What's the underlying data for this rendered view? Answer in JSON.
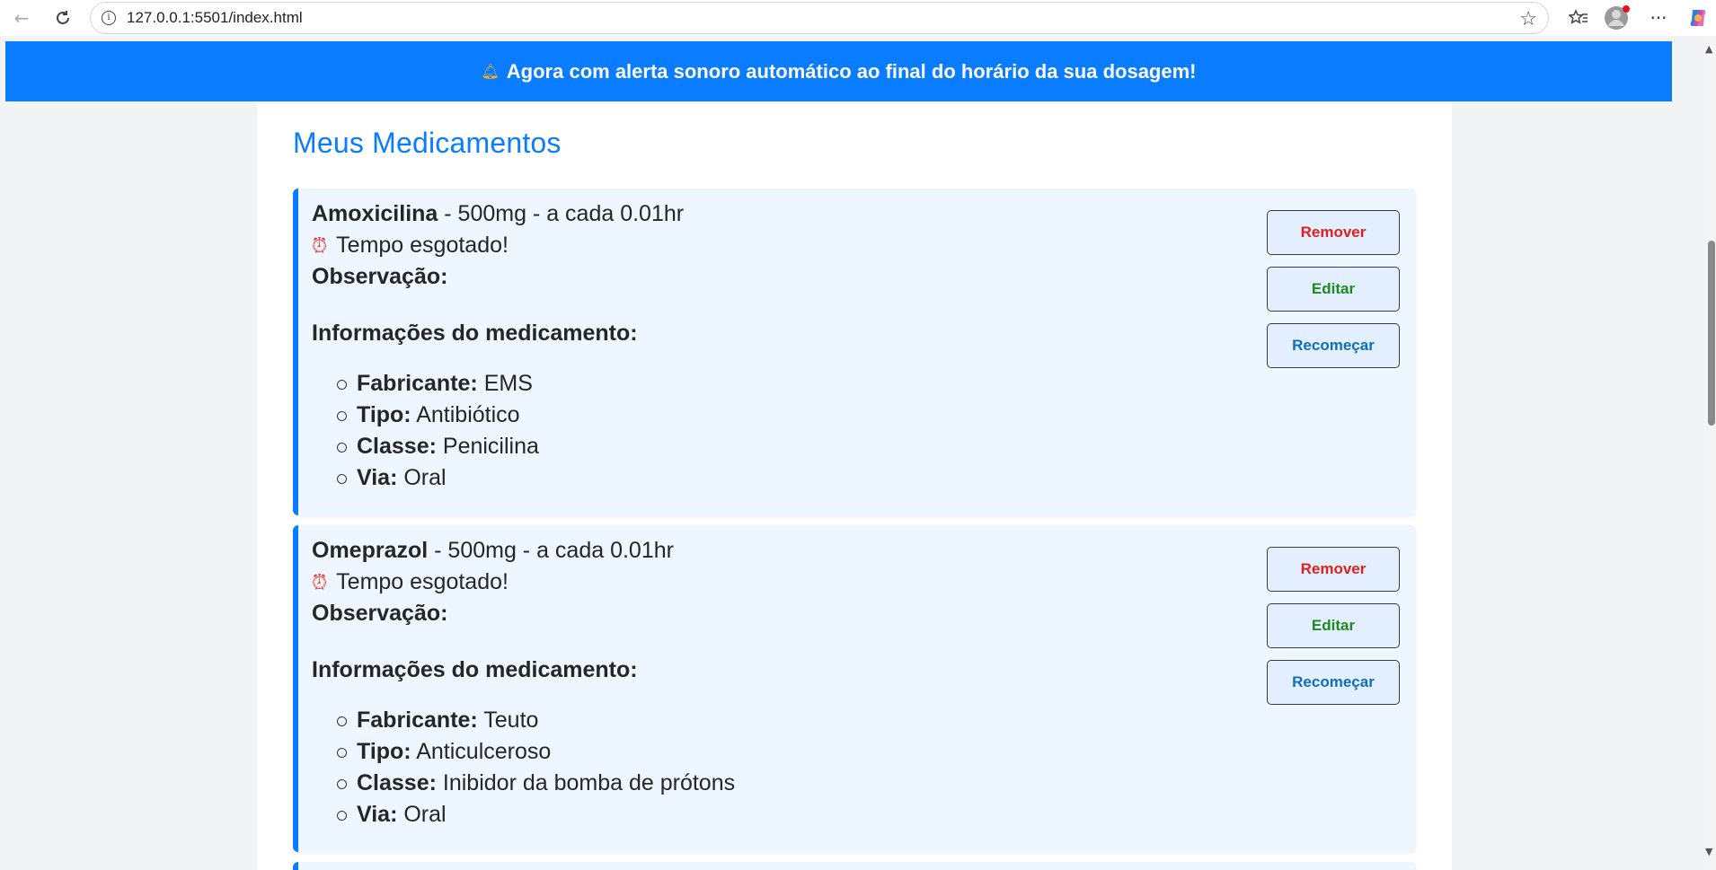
{
  "browser": {
    "url": "127.0.0.1:5501/index.html"
  },
  "banner": {
    "icon": "bell-icon",
    "text": "Agora com alerta sonoro automático ao final do horário da sua dosagem!"
  },
  "page": {
    "title": "Meus Medicamentos"
  },
  "medications": [
    {
      "name": "Amoxicilina",
      "dose_text": " - 500mg - a cada 0.01hr",
      "timer_text": "Tempo esgotado!",
      "observation_label": "Observação:",
      "info_heading": "Informações do medicamento:",
      "info": [
        {
          "label": "Fabricante:",
          "value": " EMS"
        },
        {
          "label": "Tipo:",
          "value": " Antibiótico"
        },
        {
          "label": "Classe:",
          "value": " Penicilina"
        },
        {
          "label": "Via:",
          "value": " Oral"
        }
      ],
      "buttons": {
        "remove": "Remover",
        "edit": "Editar",
        "restart": "Recomeçar"
      }
    },
    {
      "name": "Omeprazol",
      "dose_text": " - 500mg - a cada 0.01hr",
      "timer_text": "Tempo esgotado!",
      "observation_label": "Observação:",
      "info_heading": "Informações do medicamento:",
      "info": [
        {
          "label": "Fabricante:",
          "value": " Teuto"
        },
        {
          "label": "Tipo:",
          "value": " Anticulceroso"
        },
        {
          "label": "Classe:",
          "value": " Inibidor da bomba de prótons"
        },
        {
          "label": "Via:",
          "value": " Oral"
        }
      ],
      "buttons": {
        "remove": "Remover",
        "edit": "Editar",
        "restart": "Recomeçar"
      }
    }
  ],
  "colors": {
    "accent": "#0a7cff",
    "card_bg": "#eef6ff",
    "remove": "#e0201a",
    "edit": "#1f8a1f",
    "restart": "#0d6ebd"
  }
}
